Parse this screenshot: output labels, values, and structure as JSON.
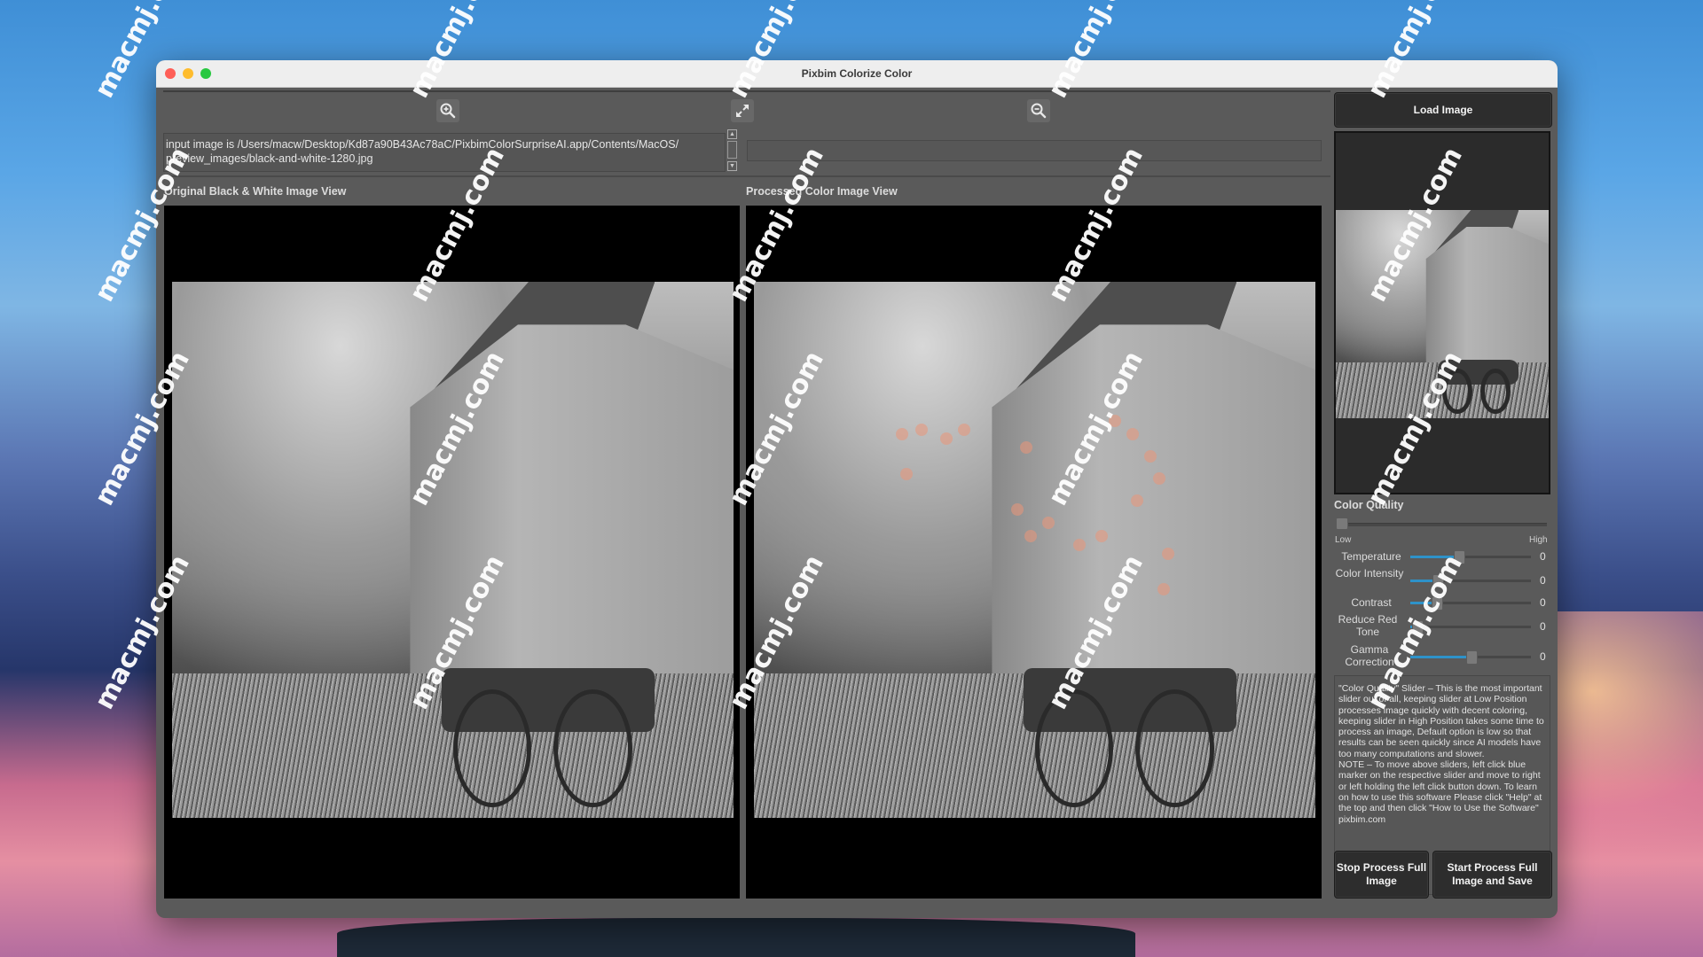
{
  "window": {
    "title": "Pixbim Colorize Color",
    "controls": [
      "close",
      "minimize",
      "maximize"
    ]
  },
  "toolbar": {
    "zoom_in_icon": "zoom-in-icon",
    "fit_icon": "expand-arrows-icon",
    "zoom_out_icon": "zoom-out-icon"
  },
  "info_log": {
    "lines": [
      "input image is /Users/macw/Desktop/Kd87a90B43Ac78aC/PixbimColorSurpriseAI.app/Contents/MacOS/",
      "preview_images/black-and-white-1280.jpg"
    ]
  },
  "status_field": {
    "value": ""
  },
  "views": {
    "original_label": "Original Black & White  Image View",
    "processed_label": "Processed Color Image View"
  },
  "right_panel": {
    "load_button": "Load Image",
    "color_quality": {
      "label": "Color Quality",
      "low_label": "Low",
      "high_label": "High",
      "position": 0.0
    },
    "sliders": [
      {
        "label": "Temperature",
        "fill_fraction": 0.4,
        "value": "0"
      },
      {
        "label": "Color Intensity",
        "fill_fraction": 0.22,
        "value": "0"
      },
      {
        "label": "Contrast",
        "fill_fraction": 0.21,
        "value": "0"
      },
      {
        "label": "Reduce Red Tone",
        "fill_fraction": 0.05,
        "value": "0"
      },
      {
        "label": "Gamma Correction",
        "fill_fraction": 0.5,
        "value": "0"
      }
    ],
    "help_text": "\"Color Quality\" Slider – This is the most important slider out of all, keeping slider at Low Position processes image quickly with decent coloring, keeping slider in High Position takes some time to process an image, Default option is low so that results can be seen quickly since AI models have too many computations and slower.\nNOTE – To move above sliders, left click blue marker on the respective slider and move to right or left holding the left click button down. To learn on how to use this software Please click \"Help\" at the top and then click \"How to Use the Software\" pixbim.com",
    "stop_button": "Stop Process Full Image",
    "start_button": "Start Process Full Image and Save"
  },
  "colors": {
    "accent": "#2e92c9",
    "window_bg": "#5a5a5a",
    "button_bg": "#2d2d2d"
  },
  "watermark": "macmj.com"
}
